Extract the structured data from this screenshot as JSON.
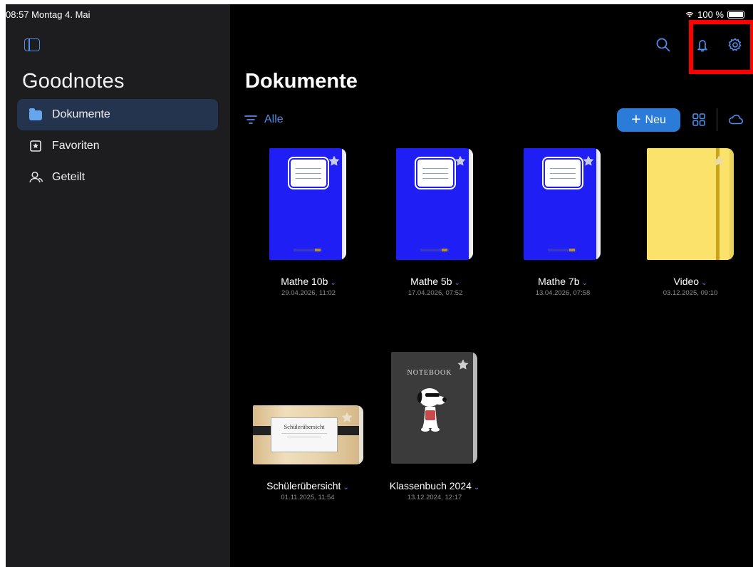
{
  "status": {
    "time_date": "08:57  Montag 4. Mai",
    "battery": "100 %"
  },
  "sidebar": {
    "app_title": "Goodnotes",
    "items": [
      {
        "label": "Dokumente",
        "icon": "folder-icon",
        "active": true
      },
      {
        "label": "Favoriten",
        "icon": "bookmark-star-icon",
        "active": false
      },
      {
        "label": "Geteilt",
        "icon": "people-icon",
        "active": false
      }
    ]
  },
  "main": {
    "title": "Dokumente",
    "filter_label": "Alle",
    "new_button_label": "Neu",
    "documents": [
      {
        "name": "Mathe 10b",
        "date": "29.04.2026, 11:02"
      },
      {
        "name": "Mathe 5b",
        "date": "17.04.2026, 07:52"
      },
      {
        "name": "Mathe 7b",
        "date": "13.04.2026, 07:58"
      },
      {
        "name": "Video",
        "date": "03.12.2025, 09:10"
      },
      {
        "name": "Schülerübersicht",
        "date": "01.11.2025, 11:54",
        "cover_text": "Schülerübersicht"
      },
      {
        "name": "Klassenbuch 2024",
        "date": "13.12.2024, 12:17",
        "cover_text": "NOTEBOOK"
      }
    ]
  },
  "colors": {
    "accent": "#4f8de8",
    "sidebar_bg": "#1d1d1f",
    "main_bg": "#000000",
    "highlight": "#ff0000",
    "notebook_blue": "#1e1ef5",
    "notebook_yellow": "#fbe26a"
  }
}
